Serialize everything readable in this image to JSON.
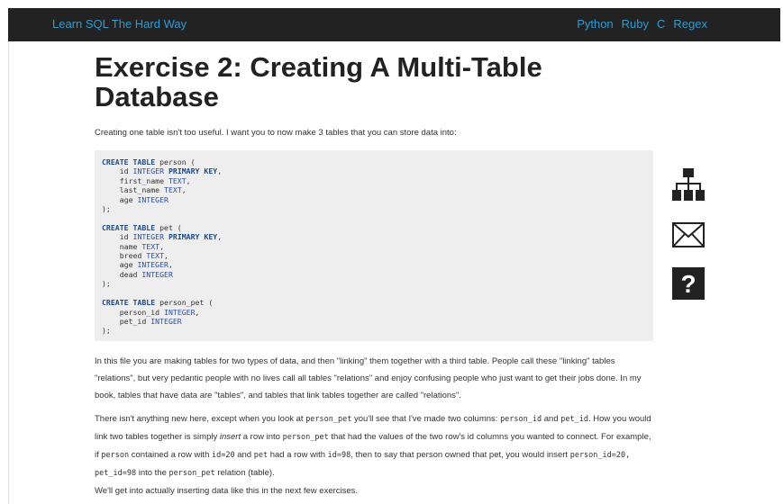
{
  "nav": {
    "brand": "Learn SQL The Hard Way",
    "links": [
      "Python",
      "Ruby",
      "C",
      "Regex"
    ]
  },
  "page": {
    "title": "Exercise 2: Creating A Multi-Table Database",
    "intro": "Creating one table isn't too useful. I want you to now make 3 tables that you can store data into:"
  },
  "code_block": {
    "person": {
      "header": "person (",
      "lines": [
        "id",
        "first_name",
        "last_name",
        "age"
      ]
    },
    "pet": {
      "header": "pet (",
      "lines": [
        "id",
        "name",
        "breed",
        "age",
        "dead"
      ]
    },
    "person_pet": {
      "header": "person_pet (",
      "lines": [
        "person_id",
        "pet_id"
      ]
    }
  },
  "para1": "In this file you are making tables for two types of data, and then \"linking\" them together with a third table. People call these \"linking\" tables \"relations\", but very pedantic people with no lives call all tables \"relations\" and enjoy confusing people who just want to get their jobs done. In my book, tables that have data are \"tables\", and tables that link tables together are called \"relations\".",
  "para2": {
    "t1": "There isn't anything new here, except when you look at ",
    "c1": "person_pet",
    "t2": " you'll see that I've made two columns: ",
    "c2": "person_id",
    "t3": " and ",
    "c3": "pet_id",
    "t4": ". How you would link two tables together is simply ",
    "em": "insert",
    "t5": " a row into ",
    "c4": "person_pet",
    "t6": " that had the values of the two row's id columns you wanted to connect. For example, if ",
    "c5": "person",
    "t7": " contained a row with ",
    "c6": "id=20",
    "t8": " and ",
    "c7": "pet",
    "t9": " had a row with ",
    "c8": "id=98",
    "t10": ", then to say that person owned that pet, you would insert ",
    "c9": "person_id=20, pet_id=98",
    "t11": " into the ",
    "c10": "person_pet",
    "t12": " relation (table)."
  },
  "para3": "We'll get into actually inserting data like this in the next few exercises.",
  "sidebar_icons": [
    "sitemap-icon",
    "envelope-icon",
    "question-icon"
  ]
}
